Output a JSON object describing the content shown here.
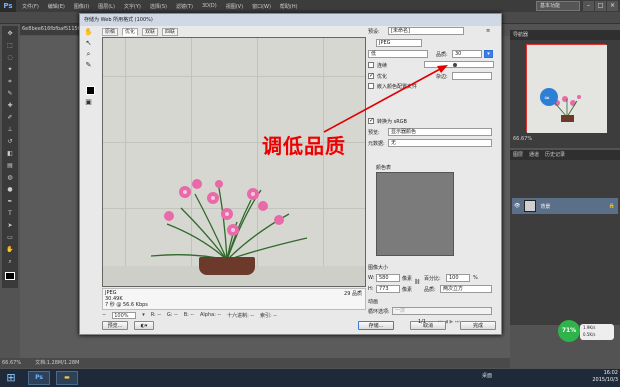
{
  "app": {
    "logo": "Ps",
    "menus": [
      "文件(F)",
      "编辑(E)",
      "图像(I)",
      "图层(L)",
      "文字(Y)",
      "选择(S)",
      "滤镜(T)",
      "3D(D)",
      "视图(V)",
      "窗口(W)",
      "帮助(H)"
    ],
    "workspace": "基本功能",
    "window_buttons": [
      "–",
      "□",
      "×"
    ],
    "doc_tab": "6e8bee616fbfbaf5115ff",
    "doc_zoom": "66.67%",
    "doc_size": "文档:1.28M/1.28M"
  },
  "dialog": {
    "title": "存储为 Web 所用格式 (100%)",
    "preview_tabs": [
      "原稿",
      "优化",
      "双联",
      "四联"
    ],
    "active_tab": "优化",
    "preset_label": "预设:",
    "preset_value": "[未命名]",
    "format_value": "JPEG",
    "compression_value": "低",
    "quality_label": "品质:",
    "quality_value": "30",
    "progressive_label": "连续",
    "optimized_label": "优化",
    "embed_profile_label": "嵌入颜色配置文件",
    "blur_label": "模糊:",
    "matte_label": "杂边:",
    "convert_srgb_label": "转换为 sRGB",
    "preview_label": "预览:",
    "preview_value": "显示器颜色",
    "metadata_label": "元数据:",
    "metadata_value": "无",
    "color_table_label": "颜色表",
    "image_size_label": "图像大小",
    "width_label": "W:",
    "width_value": "580",
    "height_label": "H:",
    "height_value": "773",
    "px_unit": "像素",
    "percent_label": "百分比:",
    "percent_value": "100",
    "percent_unit": "%",
    "quality2_label": "品质:",
    "quality2_value": "两次立方",
    "animation_label": "动画",
    "loop_label": "循环选项:",
    "loop_value": "一次",
    "frame_counter": "1/1",
    "info_format": "JPEG",
    "info_size": "30.49K",
    "info_time": "7 秒 @ 56.6 Kbps",
    "info_quality": "29 品质",
    "zoom_value": "100%",
    "status_items": [
      "R: --",
      "G: --",
      "B: --",
      "Alpha: --",
      "十六进制: --",
      "索引: --"
    ],
    "preview_button": "预览...",
    "save_button": "存储...",
    "cancel_button": "取消",
    "done_button": "完成"
  },
  "annotation": "调低品质",
  "panels": {
    "navigator_tabs": "导航器",
    "navigator_zoom": "66.67%",
    "layer_tabs": [
      "图层",
      "通道",
      "历史记录"
    ],
    "layer_name": "背景"
  },
  "system": {
    "badge": "71%",
    "up_speed": "1.9K/s",
    "down_speed": "0.5K/s",
    "desktop_label": "桌面",
    "time": "16:02",
    "date": "2015/10/3"
  },
  "colors": {
    "annotation": "#e00000",
    "ps_dark": "#3c3c3c",
    "dialog_bg": "#e9e9e9"
  }
}
